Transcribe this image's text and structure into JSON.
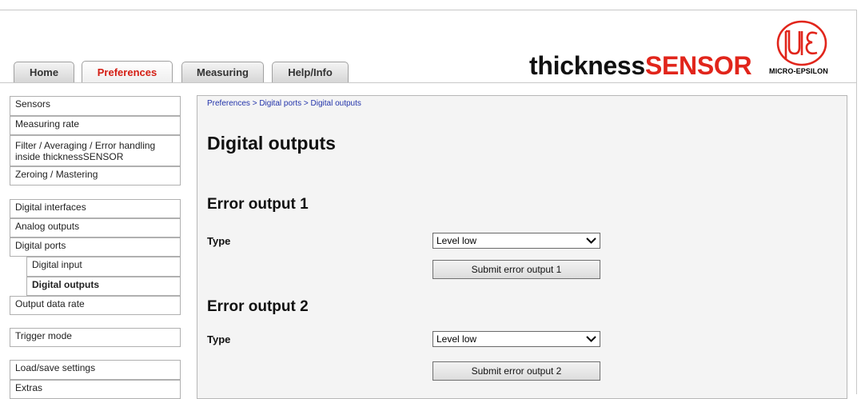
{
  "tabs": [
    "Home",
    "Preferences",
    "Measuring",
    "Help/Info"
  ],
  "brand": {
    "part1": "thickness",
    "part2": "SENSOR",
    "logo_text": "MICRO-EPSILON",
    "logo_icon": "micro-epsilon-logo"
  },
  "colors": {
    "brand_red": "#e1251b",
    "active_tab": "#d41e14",
    "link": "#2233aa",
    "panel_bg": "#f4f4f4"
  },
  "sidebar": {
    "items": [
      "Sensors",
      "Measuring rate",
      "Filter / Averaging / Error handling inside thicknessSENSOR",
      "Zeroing / Mastering",
      "Digital interfaces",
      "Analog outputs",
      "Digital ports",
      "Digital input",
      "Digital outputs",
      "Output data rate",
      "Trigger mode",
      "Load/save settings",
      "Extras"
    ]
  },
  "main": {
    "breadcrumb": "Preferences > Digital ports > Digital outputs",
    "title": "Digital outputs",
    "error1": {
      "heading": "Error output 1",
      "type_label": "Type",
      "type_value": "Level low",
      "submit": "Submit error output 1"
    },
    "error2": {
      "heading": "Error output 2",
      "type_label": "Type",
      "type_value": "Level low",
      "submit": "Submit error output 2"
    }
  }
}
